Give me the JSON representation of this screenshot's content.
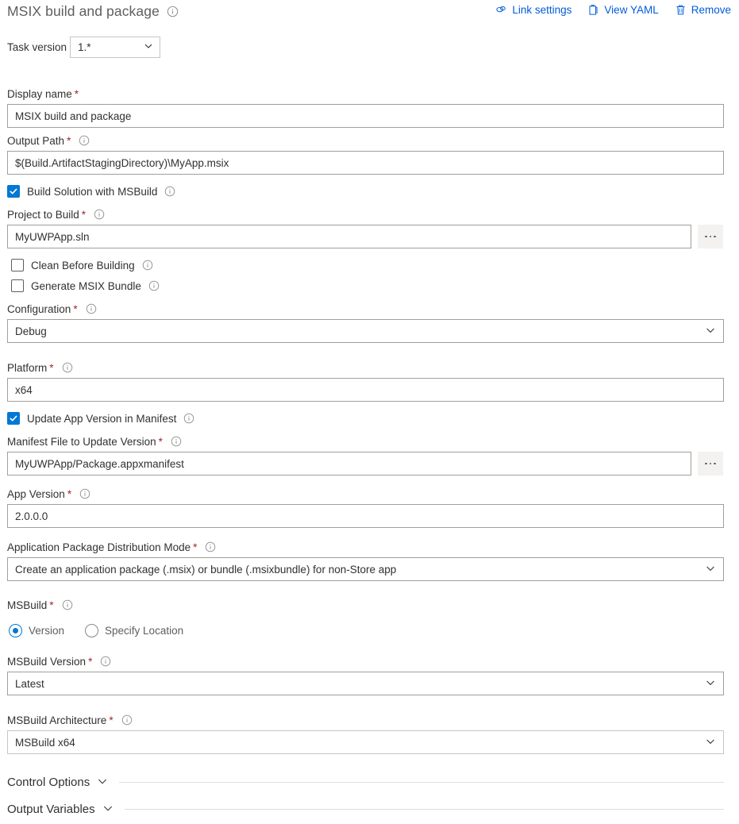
{
  "header": {
    "title": "MSIX build and package",
    "info_icon": "info-icon",
    "actions": [
      {
        "label": "Link settings",
        "icon": "link-icon"
      },
      {
        "label": "View YAML",
        "icon": "clipboard-icon"
      },
      {
        "label": "Remove",
        "icon": "trash-icon"
      }
    ],
    "link_color": "#015cda"
  },
  "task_version": {
    "label": "Task version",
    "value": "1.*",
    "chevron_icon": "chevron-down-icon"
  },
  "fields": {
    "display_name": {
      "label": "Display name",
      "required": "*",
      "value": "MSIX build and package"
    },
    "output_path": {
      "label": "Output Path",
      "required": "*",
      "value": "$(Build.ArtifactStagingDirectory)\\MyApp.msix"
    },
    "build_solution_with_msbuild": {
      "label": "Build Solution with MSBuild",
      "checked": true
    },
    "project_to_build": {
      "label": "Project to Build",
      "required": "*",
      "value": "MyUWPApp.sln",
      "browse_label": "..."
    },
    "clean_before_building": {
      "label": "Clean Before Building",
      "checked": false
    },
    "generate_msix_bundle": {
      "label": "Generate MSIX Bundle",
      "checked": false
    },
    "configuration": {
      "label": "Configuration",
      "required": "*",
      "value": "Debug"
    },
    "platform": {
      "label": "Platform",
      "required": "*",
      "value": "x64"
    },
    "update_app_version_in_manifest": {
      "label": "Update App Version in Manifest",
      "checked": true
    },
    "manifest_file": {
      "label": "Manifest File to Update Version",
      "required": "*",
      "value": "MyUWPApp/Package.appxmanifest",
      "browse_label": "..."
    },
    "app_version": {
      "label": "App Version",
      "required": "*",
      "value": "2.0.0.0"
    },
    "distribution_mode": {
      "label": "Application Package Distribution Mode",
      "required": "*",
      "value": "Create an application package (.msix) or bundle (.msixbundle) for non-Store app"
    },
    "msbuild": {
      "label": "MSBuild",
      "required": "*",
      "options": [
        {
          "label": "Version",
          "selected": true
        },
        {
          "label": "Specify Location",
          "selected": false
        }
      ]
    },
    "msbuild_version": {
      "label": "MSBuild Version",
      "required": "*",
      "value": "Latest"
    },
    "msbuild_architecture": {
      "label": "MSBuild Architecture",
      "required": "*",
      "value": "MSBuild x64"
    }
  },
  "sections": [
    {
      "title": "Control Options",
      "chevron_icon": "chevron-down-icon"
    },
    {
      "title": "Output Variables",
      "chevron_icon": "chevron-down-icon"
    }
  ]
}
